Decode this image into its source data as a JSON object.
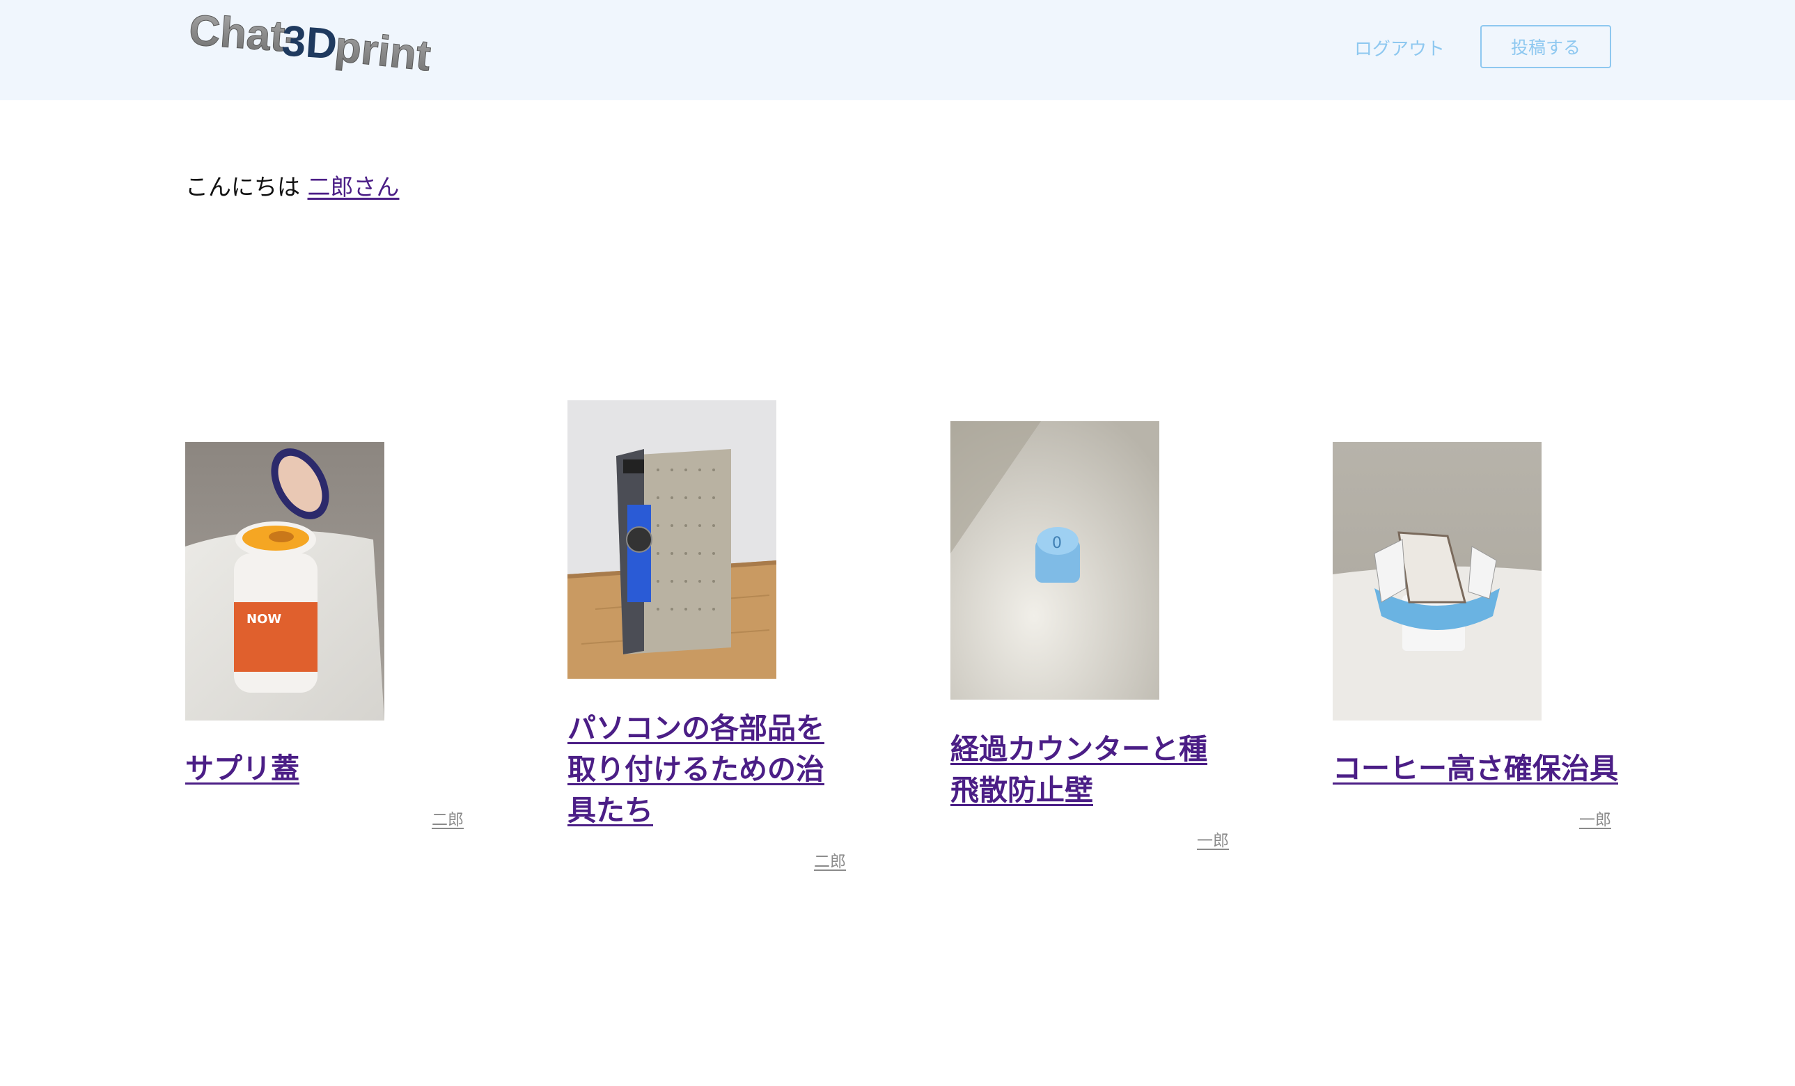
{
  "header": {
    "logo_text": "Chat-3Dprint",
    "logout_label": "ログアウト",
    "post_label": "投稿する"
  },
  "greeting": {
    "prefix": "こんにちは",
    "user_link": "二郎さん"
  },
  "posts": [
    {
      "title": "サプリ蓋",
      "author": "二郎",
      "image": "supplement-bottle-photo"
    },
    {
      "title": "パソコンの各部品を取り付けるための治具たち",
      "author": "二郎",
      "image": "pc-case-photo"
    },
    {
      "title": "経過カウンターと種飛散防止壁",
      "author": "一郎",
      "image": "blue-counter-photo"
    },
    {
      "title": "コーヒー高さ確保治具",
      "author": "一郎",
      "image": "coffee-drip-holder-photo"
    }
  ],
  "colors": {
    "header_bg": "#f0f6fd",
    "nav_accent": "#8ec8f0",
    "link": "#4b1e86",
    "author": "#8a8a8a"
  }
}
